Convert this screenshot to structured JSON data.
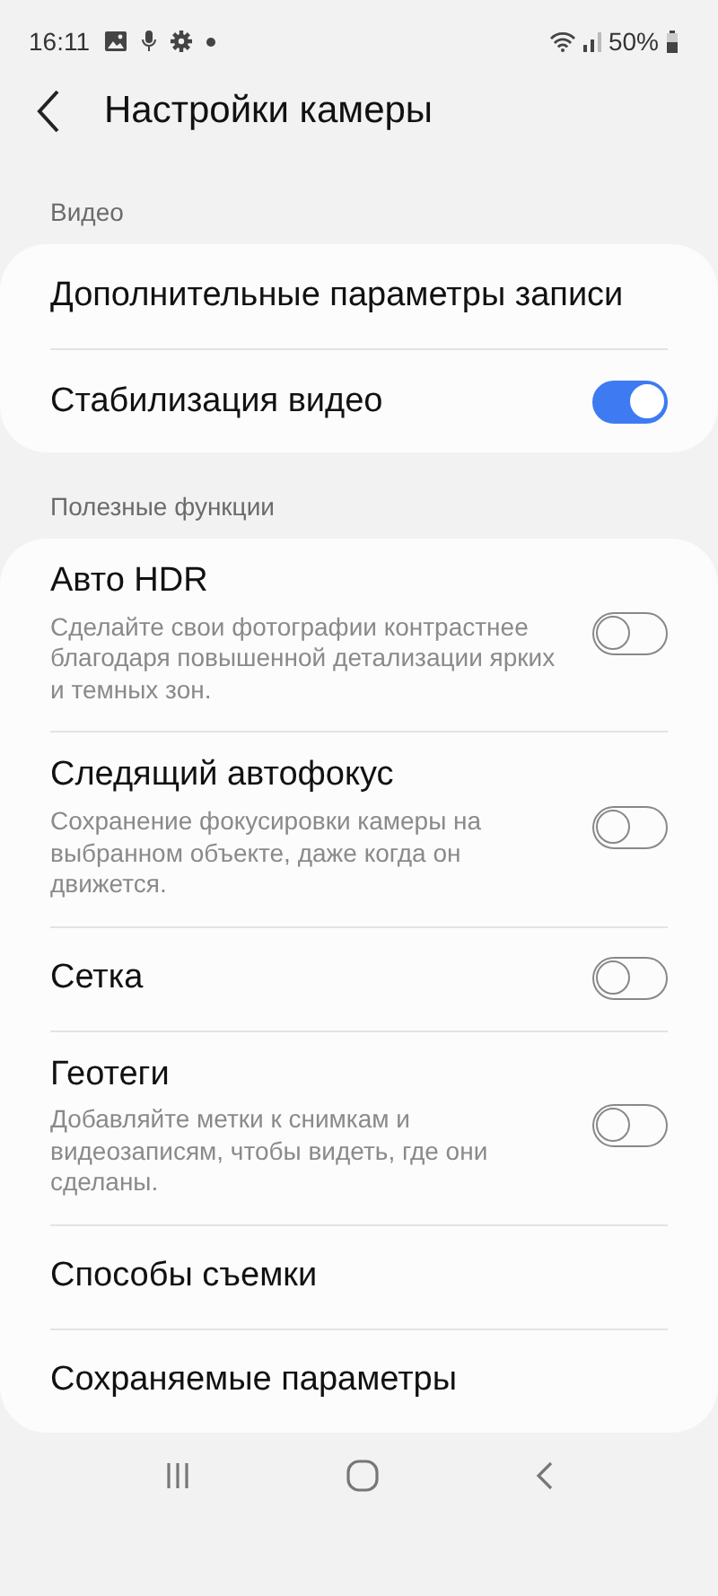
{
  "status_bar": {
    "time": "16:11",
    "battery": "50%"
  },
  "header": {
    "title": "Настройки камеры"
  },
  "sections": [
    {
      "title": "Видео",
      "items": [
        {
          "kind": "link",
          "title": "Дополнительные параметры записи"
        },
        {
          "kind": "switch",
          "title": "Стабилизация видео",
          "on": true
        }
      ]
    },
    {
      "title": "Полезные функции",
      "items": [
        {
          "kind": "switch",
          "title": "Авто HDR",
          "subtitle": "Сделайте свои фотографии контрастнее благодаря повышенной детализации ярких и темных зон.",
          "on": false
        },
        {
          "kind": "switch",
          "title": "Следящий автофокус",
          "subtitle": "Сохранение фокусировки камеры на выбранном объекте, даже когда он движется.",
          "on": false
        },
        {
          "kind": "switch",
          "title": "Сетка",
          "on": false
        },
        {
          "kind": "switch",
          "title": "Геотеги",
          "subtitle": "Добавляйте метки к снимкам и видеозаписям, чтобы видеть, где они сделаны.",
          "on": false
        },
        {
          "kind": "link",
          "title": "Способы съемки"
        },
        {
          "kind": "link",
          "title": "Сохраняемые параметры"
        }
      ]
    }
  ]
}
